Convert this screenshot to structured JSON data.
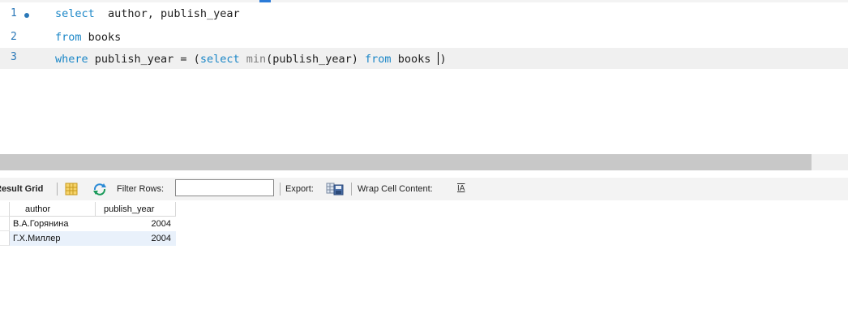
{
  "editor": {
    "lines": [
      {
        "number": "1",
        "tokens": {
          "kw": "select",
          "rest": "  author, publish_year"
        }
      },
      {
        "number": "2",
        "tokens": {
          "kw": "from",
          "rest": " books"
        }
      },
      {
        "number": "3",
        "tokens": {
          "kw1": "where",
          "t1": " publish_year = (",
          "kw2": "select",
          "t2": " ",
          "fn": "min",
          "t3": "(publish_year) ",
          "kw3": "from",
          "t4": " books ",
          "t5": ")"
        }
      }
    ]
  },
  "toolbar": {
    "result_grid_label": "Result Grid",
    "filter_rows_label": "Filter Rows:",
    "filter_rows_value": "",
    "export_label": "Export:",
    "wrap_cell_label": "Wrap Cell Content:",
    "wrap_icon_glyph": "IA"
  },
  "grid": {
    "columns": [
      "author",
      "publish_year"
    ],
    "rows": [
      [
        "В.А.Горянина",
        "2004"
      ],
      [
        "Г.Х.Миллер",
        "2004"
      ]
    ]
  },
  "colors": {
    "keyword": "#1a86c7",
    "line_number": "#2a78b8",
    "selected_row_bg": "#e9f1fb"
  }
}
